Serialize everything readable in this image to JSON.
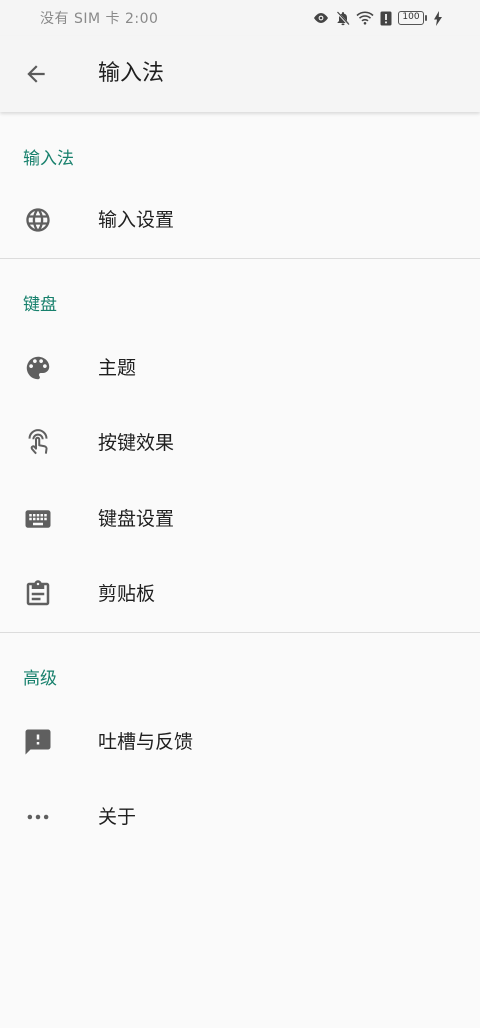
{
  "status_bar": {
    "left_text": "没有 SIM 卡 2:00",
    "battery_level": "100",
    "icons": [
      "eye-icon",
      "bell-off-icon",
      "wifi-icon",
      "alert-icon",
      "battery-icon",
      "charging-icon"
    ]
  },
  "app_bar": {
    "title": "输入法",
    "back_icon": "arrow-back-icon"
  },
  "sections": [
    {
      "header": "输入法",
      "items": [
        {
          "label": "输入设置",
          "icon": "globe-icon"
        }
      ]
    },
    {
      "header": "键盘",
      "items": [
        {
          "label": "主题",
          "icon": "palette-icon"
        },
        {
          "label": "按键效果",
          "icon": "touch-icon"
        },
        {
          "label": "键盘设置",
          "icon": "keyboard-icon"
        },
        {
          "label": "剪贴板",
          "icon": "clipboard-icon"
        }
      ]
    },
    {
      "header": "高级",
      "items": [
        {
          "label": "吐槽与反馈",
          "icon": "feedback-icon"
        },
        {
          "label": "关于",
          "icon": "more-horiz-icon"
        }
      ]
    }
  ],
  "colors": {
    "accent": "#17806c",
    "background": "#fafafa",
    "icon": "#5f5f5f",
    "divider": "#dcdcdc"
  }
}
